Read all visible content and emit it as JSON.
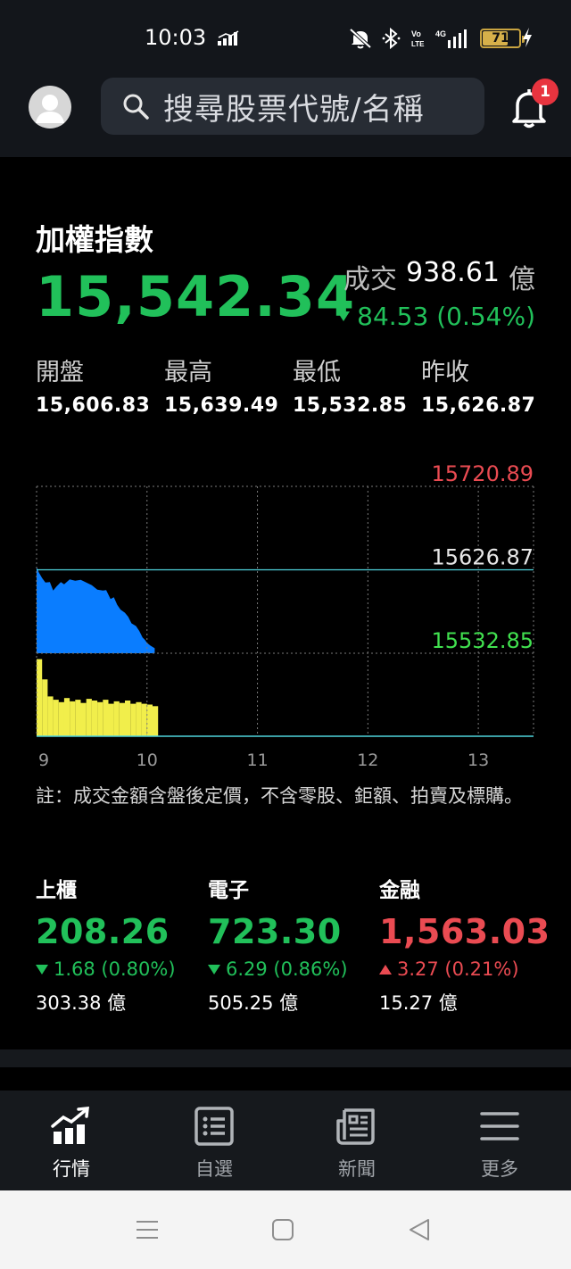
{
  "status_bar": {
    "time": "10:03",
    "battery_level": "71",
    "battery_fraction": 0.71,
    "icons": [
      "network-activity-icon",
      "mute-icon",
      "bluetooth-icon",
      "volte-icon",
      "signal-4g-icon",
      "battery-icon",
      "charging-icon"
    ]
  },
  "header": {
    "search_placeholder": "搜尋股票代號/名稱",
    "notification_count": "1"
  },
  "index": {
    "title": "加權指數",
    "price": "15,542.34",
    "volume_label": "成交",
    "volume_value": "938.61",
    "volume_unit": "億",
    "change": "84.53 (0.54%)",
    "direction": "down",
    "stats": [
      {
        "label": "開盤",
        "value": "15,606.83"
      },
      {
        "label": "最高",
        "value": "15,639.49"
      },
      {
        "label": "最低",
        "value": "15,532.85"
      },
      {
        "label": "昨收",
        "value": "15,626.87"
      }
    ]
  },
  "chart_data": {
    "type": "area",
    "x_ticks": [
      "9",
      "10",
      "11",
      "12",
      "13"
    ],
    "x_range": [
      9,
      13.5
    ],
    "y_levels": [
      {
        "label": "15720.89",
        "value": 15720.89,
        "color": "#ea4b52"
      },
      {
        "label": "15626.87",
        "value": 15626.87,
        "color": "#e6e6e6"
      },
      {
        "label": "15532.85",
        "value": 15532.85,
        "color": "#41e14f"
      }
    ],
    "ylim": [
      15532.85,
      15720.89
    ],
    "reference": 15626.87,
    "price_series": {
      "x": [
        9.0,
        9.02,
        9.05,
        9.08,
        9.12,
        9.15,
        9.18,
        9.22,
        9.25,
        9.3,
        9.35,
        9.4,
        9.45,
        9.5,
        9.55,
        9.6,
        9.63,
        9.67,
        9.7,
        9.73,
        9.76,
        9.8,
        9.83,
        9.86,
        9.9,
        9.93,
        9.96,
        9.98,
        10.0,
        10.03,
        10.07
      ],
      "y": [
        15630.5,
        15624.0,
        15617.5,
        15612.5,
        15613.0,
        15603.5,
        15608.0,
        15613.0,
        15610.5,
        15616.0,
        15614.5,
        15615.5,
        15612.5,
        15609.5,
        15604.5,
        15603.5,
        15604.0,
        15594.0,
        15596.0,
        15587.5,
        15582.0,
        15578.5,
        15574.0,
        15566.5,
        15563.5,
        15558.0,
        15550.5,
        15548.0,
        15544.5,
        15541.5,
        15538.5
      ]
    },
    "volume_series": {
      "x": [
        9.0,
        9.05,
        9.1,
        9.15,
        9.2,
        9.25,
        9.3,
        9.35,
        9.4,
        9.45,
        9.5,
        9.55,
        9.6,
        9.65,
        9.7,
        9.75,
        9.8,
        9.85,
        9.9,
        9.95,
        10.0,
        10.05
      ],
      "y": [
        95,
        70,
        49,
        45,
        42,
        47,
        43,
        45,
        41,
        46,
        44,
        42,
        45,
        40,
        43,
        41,
        44,
        40,
        42,
        40,
        39,
        37
      ]
    },
    "grid": true,
    "colors": {
      "price_fill": "#0a7dff",
      "volume_fill": "#f1ee4b",
      "reference_line": "#4fd4dc",
      "grid": "#7a7a7a"
    }
  },
  "chart_note": "註：成交金額含盤後定價，不含零股、鉅額、拍賣及標購。",
  "sub_indices": [
    {
      "name": "上櫃",
      "price": "208.26",
      "direction": "down",
      "change": "1.68 (0.80%)",
      "volume": "303.38 億",
      "color": "#21c05a"
    },
    {
      "name": "電子",
      "price": "723.30",
      "direction": "down",
      "change": "6.29 (0.86%)",
      "volume": "505.25 億",
      "color": "#21c05a"
    },
    {
      "name": "金融",
      "price": "1,563.03",
      "direction": "up",
      "change": "3.27 (0.21%)",
      "volume": "15.27 億",
      "color": "#ea4b52"
    }
  ],
  "bottom_nav": [
    {
      "label": "行情",
      "icon": "market-chart-icon",
      "active": true
    },
    {
      "label": "自選",
      "icon": "watchlist-icon",
      "active": false
    },
    {
      "label": "新聞",
      "icon": "news-icon",
      "active": false
    },
    {
      "label": "更多",
      "icon": "menu-icon",
      "active": false
    }
  ]
}
